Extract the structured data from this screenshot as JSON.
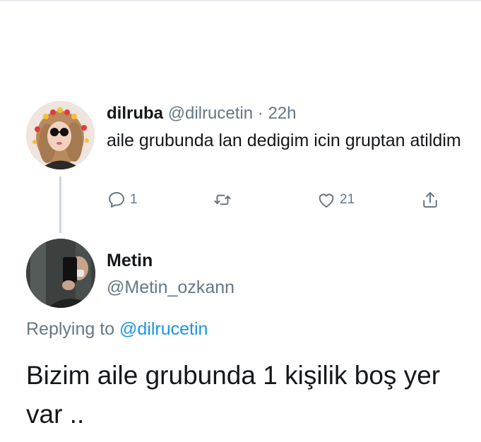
{
  "parent_tweet": {
    "name": "dilruba",
    "handle": "@dilrucetin",
    "separator": "·",
    "time": "22h",
    "text": "aile grubunda lan dedigim icin gruptan atildim",
    "reply_count": "1",
    "like_count": "21",
    "icons": [
      "reply-icon",
      "retweet-icon",
      "like-icon",
      "share-icon"
    ]
  },
  "reply_tweet": {
    "name": "Metin",
    "handle": "@Metin_ozkann",
    "replying_prefix": "Replying to",
    "replying_to": "@dilrucetin",
    "text": "Bizim aile grubunda 1 kişilik boş yer var .."
  },
  "colors": {
    "text": "#14171a",
    "secondary": "#657786",
    "link": "#1b95e0",
    "thread_line": "#ccd6dd"
  }
}
